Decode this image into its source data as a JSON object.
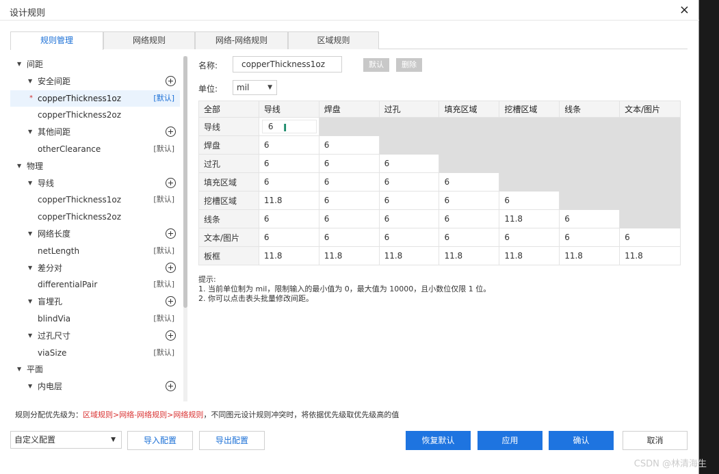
{
  "window": {
    "title": "设计规则",
    "close": "×"
  },
  "tabs": [
    "规则管理",
    "网络规则",
    "网络-网络规则",
    "区域规则"
  ],
  "tree": [
    {
      "label": "间距",
      "level": 0,
      "caret": "▼"
    },
    {
      "label": "安全间距",
      "level": 1,
      "caret": "▼",
      "add": true
    },
    {
      "label": "copperThickness1oz",
      "level": 2,
      "tag": "[默认]",
      "selected": true,
      "star": "*"
    },
    {
      "label": "copperThickness2oz",
      "level": 2
    },
    {
      "label": "其他间距",
      "level": 1,
      "caret": "▼",
      "add": true
    },
    {
      "label": "otherClearance",
      "level": 2,
      "tag": "[默认]"
    },
    {
      "label": "物理",
      "level": 0,
      "caret": "▼"
    },
    {
      "label": "导线",
      "level": 1,
      "caret": "▼",
      "add": true
    },
    {
      "label": "copperThickness1oz",
      "level": 2,
      "tag": "[默认]"
    },
    {
      "label": "copperThickness2oz",
      "level": 2
    },
    {
      "label": "网络长度",
      "level": 1,
      "caret": "▼",
      "add": true
    },
    {
      "label": "netLength",
      "level": 2,
      "tag": "[默认]"
    },
    {
      "label": "差分对",
      "level": 1,
      "caret": "▼",
      "add": true
    },
    {
      "label": "differentialPair",
      "level": 2,
      "tag": "[默认]"
    },
    {
      "label": "盲埋孔",
      "level": 1,
      "caret": "▼",
      "add": true
    },
    {
      "label": "blindVia",
      "level": 2,
      "tag": "[默认]"
    },
    {
      "label": "过孔尺寸",
      "level": 1,
      "caret": "▼",
      "add": true
    },
    {
      "label": "viaSize",
      "level": 2,
      "tag": "[默认]"
    },
    {
      "label": "平面",
      "level": 0,
      "caret": "▼"
    },
    {
      "label": "内电层",
      "level": 1,
      "caret": "▼",
      "add": true
    }
  ],
  "form": {
    "name_label": "名称:",
    "name_value": "copperThickness1oz",
    "default_btn": "默认",
    "delete_btn": "删除",
    "unit_label": "单位:",
    "unit_value": "mil"
  },
  "matrix": {
    "corner": "全部",
    "columns": [
      "导线",
      "焊盘",
      "过孔",
      "填充区域",
      "挖槽区域",
      "线条",
      "文本/图片"
    ],
    "rows": [
      {
        "label": "导线",
        "values": [
          "6"
        ]
      },
      {
        "label": "焊盘",
        "values": [
          "6",
          "6"
        ]
      },
      {
        "label": "过孔",
        "values": [
          "6",
          "6",
          "6"
        ]
      },
      {
        "label": "填充区域",
        "values": [
          "6",
          "6",
          "6",
          "6"
        ]
      },
      {
        "label": "挖槽区域",
        "values": [
          "11.8",
          "6",
          "6",
          "6",
          "6"
        ]
      },
      {
        "label": "线条",
        "values": [
          "6",
          "6",
          "6",
          "6",
          "11.8",
          "6"
        ]
      },
      {
        "label": "文本/图片",
        "values": [
          "6",
          "6",
          "6",
          "6",
          "6",
          "6",
          "6"
        ]
      },
      {
        "label": "板框",
        "values": [
          "11.8",
          "11.8",
          "11.8",
          "11.8",
          "11.8",
          "11.8",
          "11.8"
        ]
      }
    ]
  },
  "hints": {
    "title": "提示:",
    "line1": "1. 当前单位制为 mil，限制输入的最小值为 0，最大值为 10000，且小数位仅限 1 位。",
    "line2": "2. 你可以点击表头批量修改间距。"
  },
  "priority": {
    "prefix": "规则分配优先级为：",
    "chain": "区域规则>网络-网络规则>网络规则",
    "suffix": "，不同图元设计规则冲突时，将依据优先级取优先级高的值"
  },
  "footer": {
    "config_value": "自定义配置",
    "import": "导入配置",
    "export": "导出配置",
    "restore": "恢复默认",
    "apply": "应用",
    "confirm": "确认",
    "cancel": "取消"
  },
  "watermark": "CSDN @林清海生",
  "colors": {
    "primary": "#1e74e0",
    "accent_text": "#1a6fd6",
    "priority_red": "#d93030",
    "gray_cell": "#dedede"
  }
}
